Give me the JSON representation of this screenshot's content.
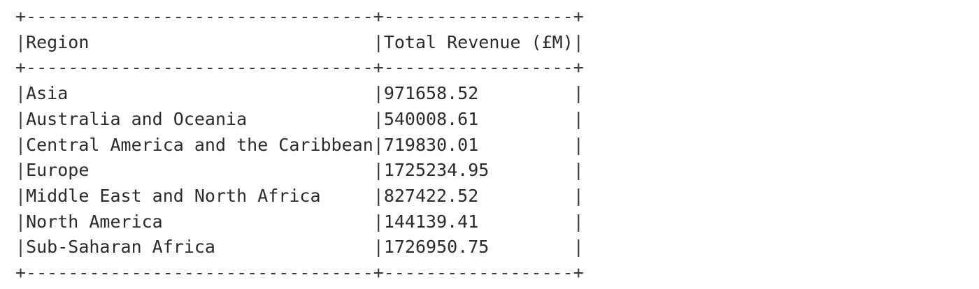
{
  "table": {
    "columns": [
      "Region",
      "Total Revenue (£M)"
    ],
    "rows": [
      {
        "region": "Asia",
        "total_revenue": "971658.52"
      },
      {
        "region": "Australia and Oceania",
        "total_revenue": "540008.61"
      },
      {
        "region": "Central America and the Caribbean",
        "total_revenue": "719830.01"
      },
      {
        "region": "Europe",
        "total_revenue": "1725234.95"
      },
      {
        "region": "Middle East and North Africa",
        "total_revenue": "827422.52"
      },
      {
        "region": "North America",
        "total_revenue": "144139.41"
      },
      {
        "region": "Sub-Saharan Africa",
        "total_revenue": "1726950.75"
      }
    ]
  }
}
